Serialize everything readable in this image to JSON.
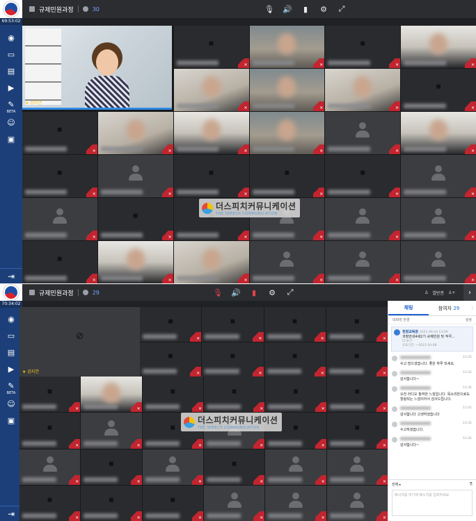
{
  "screen1": {
    "course_title": "규제민원과정",
    "participant_count": "30",
    "timer": "69:53:02",
    "host_label": "★ 강지연",
    "sidebar_beta": "BETA"
  },
  "screen2": {
    "course_title": "규제민원과정",
    "participant_count": "29",
    "timer": "70:34:02",
    "host_label": "★ 강지연",
    "sidebar_beta": "BETA",
    "right_user": "열반권",
    "chat": {
      "tab_chat": "채팅",
      "tab_participants": "참여자",
      "participants_count": "29",
      "sub_left": "대화방 변경",
      "sub_right": "설정",
      "notice_sender": "천원교육원",
      "notice_time": "2021-09-24 13:09",
      "notice_text": "과정안내4세2기 규제민원 및 적극...",
      "notice_more": "더 보기",
      "notice_period": "유효기간: ~2021-10-08",
      "messages": [
        {
          "time": "11:41",
          "text": "수고 많으셨습니다. 좋은 하루 되세요."
        },
        {
          "time": "11:41",
          "text": "감사합니다~"
        },
        {
          "time": "11:41",
          "text": "오전 라디오 참여한 느낌입니다. 목소리만으로도 힐링되는 느낌이어서 감사드립니다."
        },
        {
          "time": "11:41",
          "text": "감사합니다 고생하셨습니다"
        },
        {
          "time": "11:41",
          "text": "수고하셨습니다."
        },
        {
          "time": "11:41",
          "text": "감사합니다~"
        }
      ],
      "footer_label": "전체 ▸",
      "input_placeholder": "메시지를 여기에 메시지를 입력하세요"
    }
  },
  "watermark": {
    "korean": "더스피치커뮤니케이션",
    "english": "THE SPEECH COMMUNICATION"
  },
  "icons": {
    "mic": "mic-icon",
    "speaker": "speaker-icon",
    "camera": "camera-icon",
    "settings": "gear-icon",
    "fullscreen": "fullscreen-icon"
  },
  "colors": {
    "accent": "#1c3f7a",
    "mute_red": "#c2252f",
    "highlight": "#2f8ae2"
  }
}
